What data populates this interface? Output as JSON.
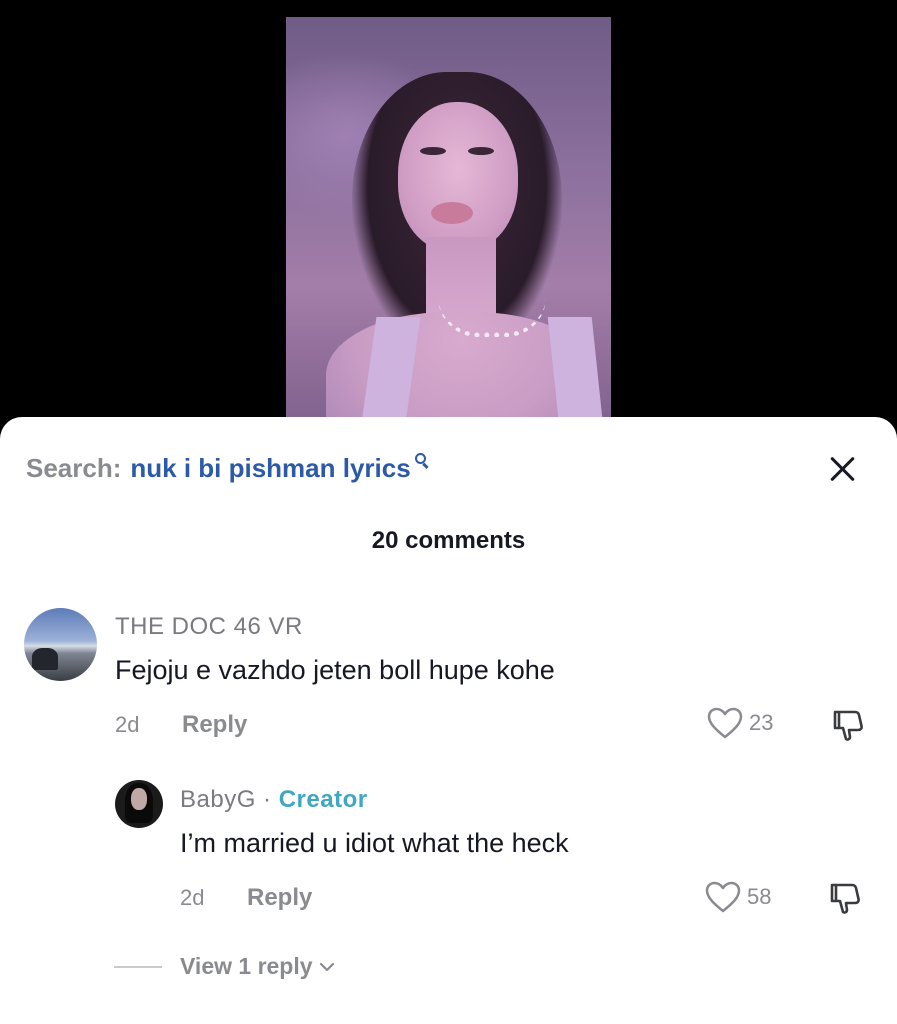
{
  "search": {
    "label": "Search:",
    "query": "nuk i bi pishman lyrics"
  },
  "comments_header": {
    "count_label": "20 comments"
  },
  "comments": [
    {
      "username": "THE DOC 46 VR",
      "text": "Fejoju e vazhdo jeten boll hupe kohe",
      "date": "2d",
      "reply_label": "Reply",
      "likes": "23"
    }
  ],
  "replies": [
    {
      "username": "BabyG",
      "separator": "·",
      "badge": "Creator",
      "text": "I’m married u idiot what the heck",
      "date": "2d",
      "reply_label": "Reply",
      "likes": "58"
    }
  ],
  "view_more": {
    "label": "View 1 reply"
  },
  "colors": {
    "accent_link": "#2c5aa8",
    "creator_badge": "#3fa7c1",
    "muted_text": "#8a8b91"
  },
  "icons": [
    "close-icon",
    "search-icon",
    "heart-icon",
    "dislike-icon",
    "chevron-down-icon"
  ]
}
